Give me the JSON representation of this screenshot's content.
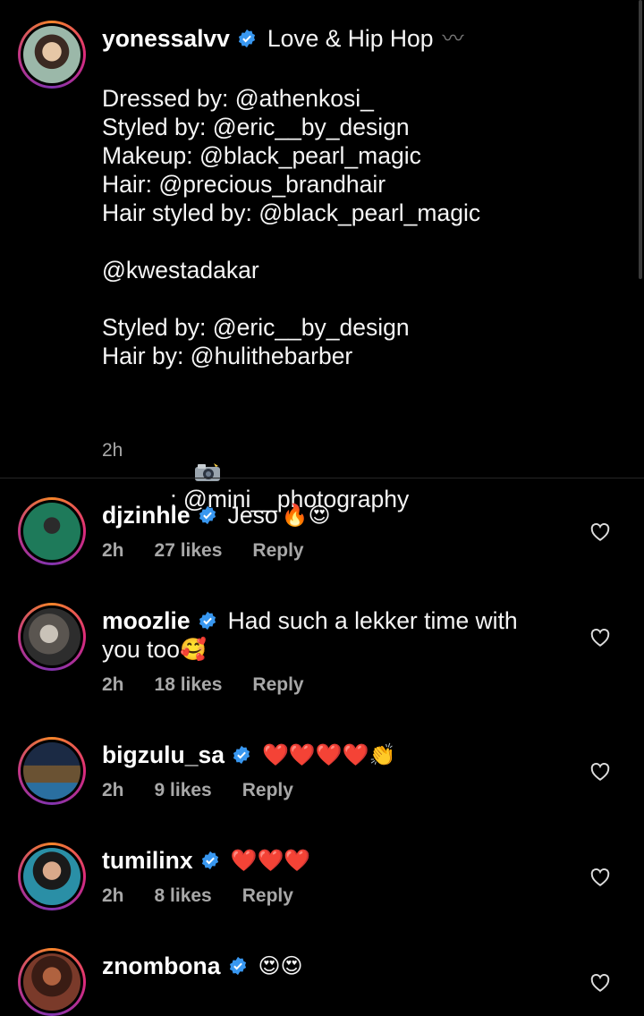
{
  "caption": {
    "username": "yonessalvv",
    "title": "Love & Hip Hop",
    "title_emoji": "〰",
    "lines": [
      "Dressed by: @athenkosi_",
      "Styled by: @eric__by_design",
      "Makeup: @black_pearl_magic",
      "Hair: @precious_brandhair",
      "Hair styled by: @black_pearl_magic",
      "",
      "@kwestadakar",
      "",
      "Styled by: @eric__by_design",
      "Hair by: @hulithebarber",
      ""
    ],
    "photo_credit": ": @mini__photography",
    "time": "2h"
  },
  "comments": [
    {
      "username": "djzinhle",
      "text": "Jeso",
      "emoji": "🔥😍",
      "time": "2h",
      "likes": "27 likes",
      "reply": "Reply"
    },
    {
      "username": "moozlie",
      "text": "Had such a lekker time with",
      "text2": "you too",
      "emoji": "🥰",
      "time": "2h",
      "likes": "18 likes",
      "reply": "Reply"
    },
    {
      "username": "bigzulu_sa",
      "text": "",
      "emoji": "❤️❤️❤️❤️👏",
      "time": "2h",
      "likes": "9 likes",
      "reply": "Reply"
    },
    {
      "username": "tumilinx",
      "text": "",
      "emoji": "❤️❤️❤️",
      "time": "2h",
      "likes": "8 likes",
      "reply": "Reply"
    },
    {
      "username": "znombona",
      "text": "",
      "emoji": "😍😍",
      "time": "",
      "likes": "",
      "reply": ""
    }
  ],
  "colors": {
    "verified": "#3897f0",
    "meta": "#a8a8a8",
    "background": "#000000"
  },
  "icons": {
    "verified": "verified-badge-icon",
    "like": "heart-outline-icon",
    "camera": "camera-flash-icon"
  }
}
